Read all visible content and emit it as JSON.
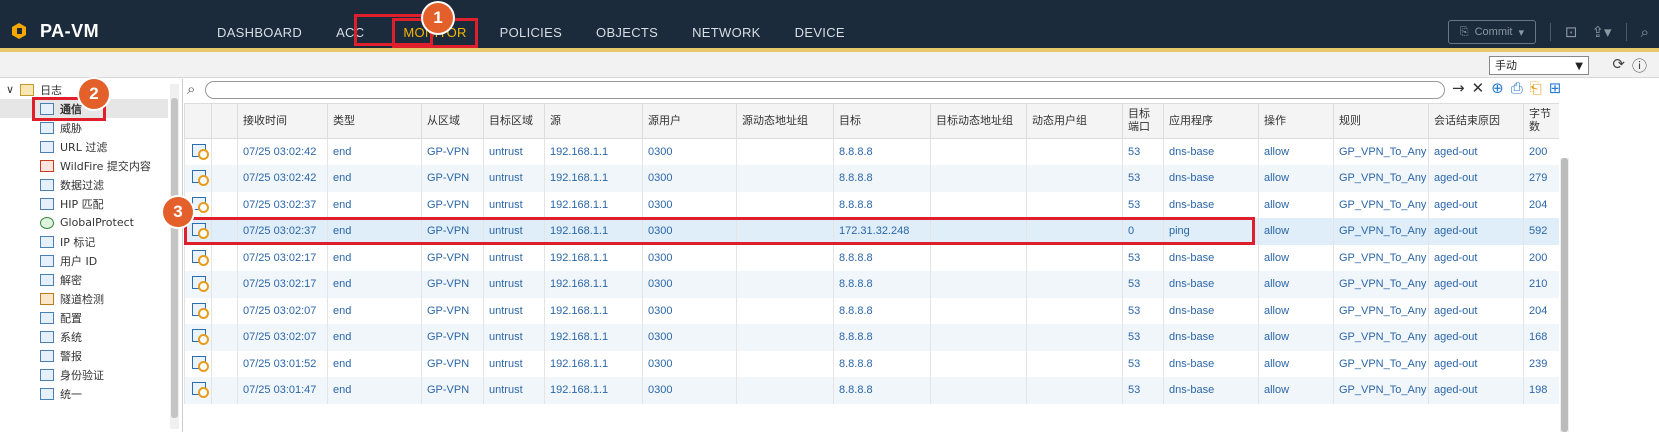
{
  "brand": {
    "logo_text": "PA-VM"
  },
  "nav": {
    "tabs": [
      "DASHBOARD",
      "ACC",
      "MONITOR",
      "POLICIES",
      "OBJECTS",
      "NETWORK",
      "DEVICE"
    ],
    "active": "MONITOR"
  },
  "toolbar": {
    "commit_label": "Commit"
  },
  "subbar": {
    "refresh_select": "手动"
  },
  "sidebar": {
    "root": "日志",
    "items": [
      "通信",
      "威胁",
      "URL 过滤",
      "WildFire 提交内容",
      "数据过滤",
      "HIP 匹配",
      "GlobalProtect",
      "IP 标记",
      "用户 ID",
      "解密",
      "隧道检测",
      "配置",
      "系统",
      "警报",
      "身份验证",
      "统一"
    ],
    "selected": "通信"
  },
  "table": {
    "columns": [
      "",
      "",
      "接收时间",
      "类型",
      "从区域",
      "目标区域",
      "源",
      "源用户",
      "源动态地址组",
      "目标",
      "目标动态地址组",
      "动态用户组",
      "目标端口",
      "应用程序",
      "操作",
      "规则",
      "会话结束原因",
      "字节数"
    ],
    "rows": [
      [
        "07/25 03:02:42",
        "end",
        "GP-VPN",
        "untrust",
        "192.168.1.1",
        "0300",
        "",
        "8.8.8.8",
        "",
        "",
        "53",
        "dns-base",
        "allow",
        "GP_VPN_To_Any",
        "aged-out",
        "200"
      ],
      [
        "07/25 03:02:42",
        "end",
        "GP-VPN",
        "untrust",
        "192.168.1.1",
        "0300",
        "",
        "8.8.8.8",
        "",
        "",
        "53",
        "dns-base",
        "allow",
        "GP_VPN_To_Any",
        "aged-out",
        "279"
      ],
      [
        "07/25 03:02:37",
        "end",
        "GP-VPN",
        "untrust",
        "192.168.1.1",
        "0300",
        "",
        "8.8.8.8",
        "",
        "",
        "53",
        "dns-base",
        "allow",
        "GP_VPN_To_Any",
        "aged-out",
        "204"
      ],
      [
        "07/25 03:02:37",
        "end",
        "GP-VPN",
        "untrust",
        "192.168.1.1",
        "0300",
        "",
        "172.31.32.248",
        "",
        "",
        "0",
        "ping",
        "allow",
        "GP_VPN_To_Any",
        "aged-out",
        "592"
      ],
      [
        "07/25 03:02:17",
        "end",
        "GP-VPN",
        "untrust",
        "192.168.1.1",
        "0300",
        "",
        "8.8.8.8",
        "",
        "",
        "53",
        "dns-base",
        "allow",
        "GP_VPN_To_Any",
        "aged-out",
        "200"
      ],
      [
        "07/25 03:02:17",
        "end",
        "GP-VPN",
        "untrust",
        "192.168.1.1",
        "0300",
        "",
        "8.8.8.8",
        "",
        "",
        "53",
        "dns-base",
        "allow",
        "GP_VPN_To_Any",
        "aged-out",
        "210"
      ],
      [
        "07/25 03:02:07",
        "end",
        "GP-VPN",
        "untrust",
        "192.168.1.1",
        "0300",
        "",
        "8.8.8.8",
        "",
        "",
        "53",
        "dns-base",
        "allow",
        "GP_VPN_To_Any",
        "aged-out",
        "204"
      ],
      [
        "07/25 03:02:07",
        "end",
        "GP-VPN",
        "untrust",
        "192.168.1.1",
        "0300",
        "",
        "8.8.8.8",
        "",
        "",
        "53",
        "dns-base",
        "allow",
        "GP_VPN_To_Any",
        "aged-out",
        "168"
      ],
      [
        "07/25 03:01:52",
        "end",
        "GP-VPN",
        "untrust",
        "192.168.1.1",
        "0300",
        "",
        "8.8.8.8",
        "",
        "",
        "53",
        "dns-base",
        "allow",
        "GP_VPN_To_Any",
        "aged-out",
        "239"
      ],
      [
        "07/25 03:01:47",
        "end",
        "GP-VPN",
        "untrust",
        "192.168.1.1",
        "0300",
        "",
        "8.8.8.8",
        "",
        "",
        "53",
        "dns-base",
        "allow",
        "GP_VPN_To_Any",
        "aged-out",
        "198"
      ]
    ],
    "highlighted_row": 3
  },
  "annotations": [
    "1",
    "2",
    "3"
  ],
  "colors": {
    "nav_bg": "#1b2b3c",
    "accent": "#f6b500",
    "annotation": "#e4602b",
    "highlight_border": "#e01f2d",
    "link": "#2b66a8"
  }
}
